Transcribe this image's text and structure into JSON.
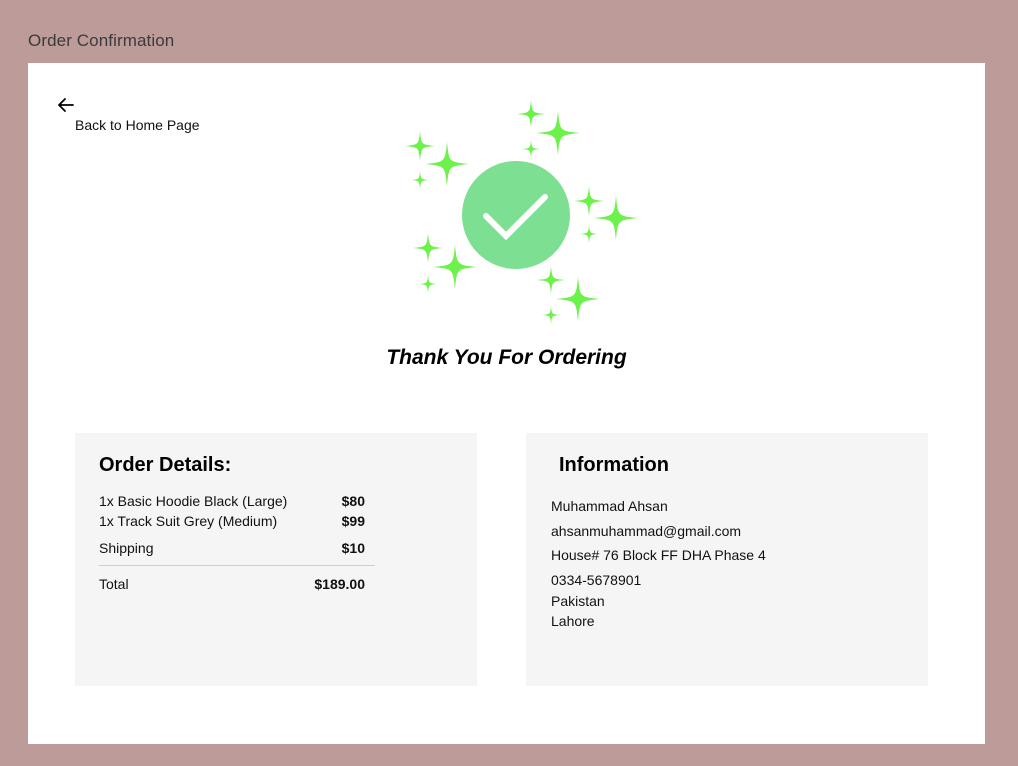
{
  "window": {
    "title": "Order Confirmation"
  },
  "nav": {
    "back_label": "Back to Home Page"
  },
  "hero": {
    "message": "Thank You For Ordering"
  },
  "colors": {
    "frame_background": "#bc9b98",
    "card_background": "#ffffff",
    "panel_background": "#f5f5f5",
    "success_circle": "#7ddf92",
    "sparkle": "#6cf24a"
  },
  "order_details": {
    "heading": "Order Details:",
    "items": [
      {
        "description": "1x Basic Hoodie Black (Large)",
        "price": "$80"
      },
      {
        "description": "1x Track Suit Grey (Medium)",
        "price": "$99"
      }
    ],
    "shipping": {
      "label": "Shipping",
      "price": "$10"
    },
    "total": {
      "label": "Total",
      "price": "$189.00"
    }
  },
  "information": {
    "heading": "Information",
    "name": "Muhammad Ahsan",
    "email": "ahsanmuhammad@gmail.com",
    "address": "House# 76 Block FF DHA Phase 4",
    "phone": "0334-5678901",
    "country": "Pakistan",
    "city": "Lahore"
  },
  "icons": {
    "back": "arrow-left-icon",
    "success": "checkmark-circle-icon",
    "decoration": "sparkle-icon"
  }
}
